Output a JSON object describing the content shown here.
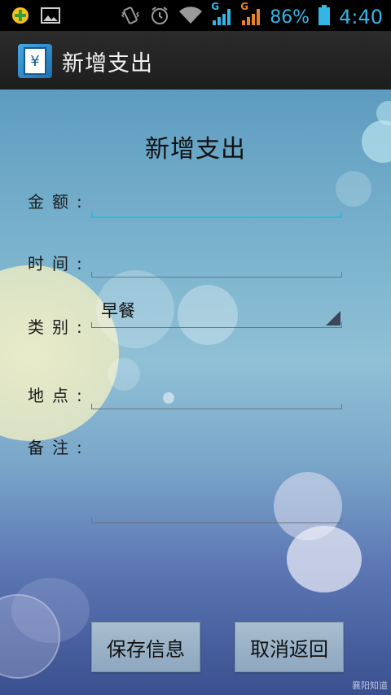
{
  "statusbar": {
    "battery_pct": "86%",
    "time": "4:40",
    "signal_label_1": "G",
    "signal_label_2": "G"
  },
  "actionbar": {
    "title": "新增支出",
    "app_icon_glyph": "¥"
  },
  "form": {
    "title": "新增支出",
    "amount_label": "金额:",
    "time_label": "时间:",
    "category_label": "类别:",
    "category_value": "早餐",
    "place_label": "地点:",
    "note_label": "备注:"
  },
  "buttons": {
    "save": "保存信息",
    "cancel": "取消返回"
  },
  "watermark": "襄阳知道",
  "colors": {
    "accent": "#33b5e5",
    "actionbar": "#222222"
  }
}
